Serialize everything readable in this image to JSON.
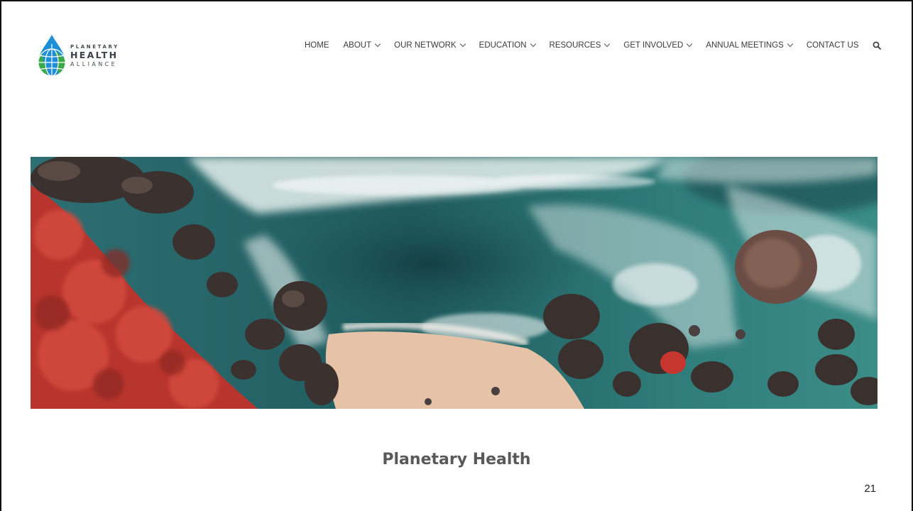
{
  "brand": {
    "line1": "PLANETARY",
    "line2": "HEALTH",
    "line3": "ALLIANCE",
    "colors": {
      "drop_blue": "#1e8fd6",
      "drop_green": "#3aa847",
      "text": "#444a52"
    }
  },
  "nav": {
    "items": [
      {
        "label": "HOME",
        "has_dropdown": false
      },
      {
        "label": "ABOUT",
        "has_dropdown": true
      },
      {
        "label": "OUR NETWORK",
        "has_dropdown": true
      },
      {
        "label": "EDUCATION",
        "has_dropdown": true
      },
      {
        "label": "RESOURCES",
        "has_dropdown": true
      },
      {
        "label": "GET INVOLVED",
        "has_dropdown": true
      },
      {
        "label": "ANNUAL MEETINGS",
        "has_dropdown": true
      },
      {
        "label": "CONTACT US",
        "has_dropdown": false
      }
    ],
    "search_icon": "search-icon"
  },
  "hero": {
    "icon": "aerial-coastline-photo"
  },
  "caption": "Planetary Health",
  "page_number": "21"
}
